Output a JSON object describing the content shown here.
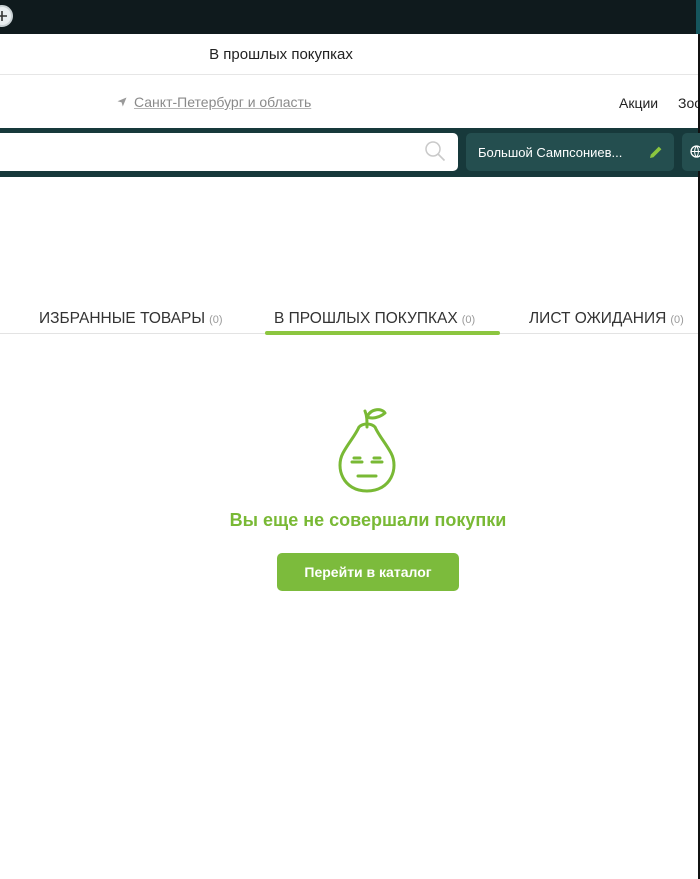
{
  "header": {
    "title": "В прошлых покупках"
  },
  "location": {
    "region": "Санкт-Петербург и область"
  },
  "nav": {
    "promo": "Акции",
    "zoo": "Зоо"
  },
  "search": {
    "placeholder": "",
    "value": ""
  },
  "store": {
    "label": "Большой Сампсониев..."
  },
  "tabs": [
    {
      "label": "ИЗБРАННЫЕ ТОВАРЫ",
      "count": "(0)",
      "active": false
    },
    {
      "label": "В ПРОШЛЫХ ПОКУПКАХ",
      "count": "(0)",
      "active": true
    },
    {
      "label": "ЛИСТ ОЖИДАНИЯ",
      "count": "(0)",
      "active": false
    }
  ],
  "empty_state": {
    "message": "Вы еще не совершали покупки",
    "button": "Перейти в каталог"
  },
  "colors": {
    "dark_teal": "#17393b",
    "teal_button": "#244e4f",
    "accent_green": "#8cc63f",
    "button_green": "#7cbb3c",
    "text_green": "#79b935"
  },
  "icons": {
    "new_tab": "plus-circle",
    "location": "location-arrow",
    "search": "magnifier",
    "edit": "pencil",
    "globe": "globe",
    "empty": "pear-face"
  }
}
